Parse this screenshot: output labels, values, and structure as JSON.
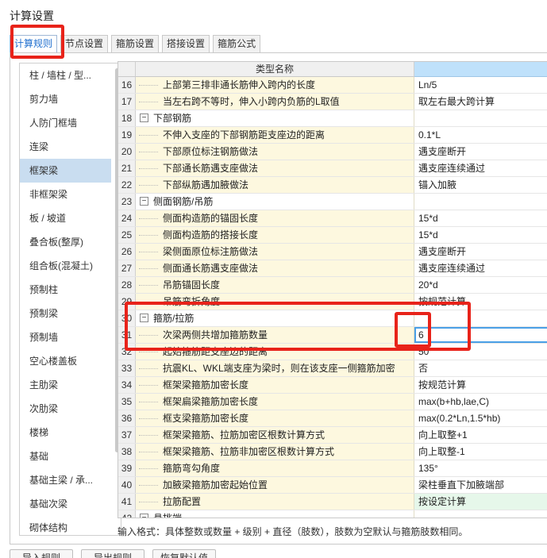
{
  "window": {
    "title": "计算设置"
  },
  "tabs": [
    {
      "label": "计算规则"
    },
    {
      "label": "节点设置"
    },
    {
      "label": "箍筋设置"
    },
    {
      "label": "搭接设置"
    },
    {
      "label": "箍筋公式"
    }
  ],
  "sidebar": {
    "items": [
      {
        "label": "柱 / 墙柱 / 型..."
      },
      {
        "label": "剪力墙"
      },
      {
        "label": "人防门框墙"
      },
      {
        "label": "连梁"
      },
      {
        "label": "框架梁"
      },
      {
        "label": "非框架梁"
      },
      {
        "label": "板 / 坡道"
      },
      {
        "label": "叠合板(整厚)"
      },
      {
        "label": "组合板(混凝土)"
      },
      {
        "label": "预制柱"
      },
      {
        "label": "预制梁"
      },
      {
        "label": "预制墙"
      },
      {
        "label": "空心楼盖板"
      },
      {
        "label": "主肋梁"
      },
      {
        "label": "次肋梁"
      },
      {
        "label": "楼梯"
      },
      {
        "label": "基础"
      },
      {
        "label": "基础主梁 / 承..."
      },
      {
        "label": "基础次梁"
      },
      {
        "label": "砌体结构"
      }
    ]
  },
  "grid": {
    "header": {
      "name": "类型名称",
      "value": ""
    },
    "rows": [
      {
        "num": "16",
        "name": "上部第三排非通长筋伸入跨内的长度",
        "value": "Ln/5"
      },
      {
        "num": "17",
        "name": "当左右跨不等时，伸入小跨内负筋的L取值",
        "value": "取左右最大跨计算"
      },
      {
        "num": "18",
        "name": "下部钢筋",
        "value": "",
        "group": "true"
      },
      {
        "num": "19",
        "name": "不伸入支座的下部钢筋距支座边的距离",
        "value": "0.1*L"
      },
      {
        "num": "20",
        "name": "下部原位标注钢筋做法",
        "value": "遇支座断开"
      },
      {
        "num": "21",
        "name": "下部通长筋遇支座做法",
        "value": "遇支座连续通过"
      },
      {
        "num": "22",
        "name": "下部纵筋遇加腋做法",
        "value": "锚入加腋"
      },
      {
        "num": "23",
        "name": "侧面钢筋/吊筋",
        "value": "",
        "group": "true"
      },
      {
        "num": "24",
        "name": "侧面构造筋的锚固长度",
        "value": "15*d"
      },
      {
        "num": "25",
        "name": "侧面构造筋的搭接长度",
        "value": "15*d"
      },
      {
        "num": "26",
        "name": "梁侧面原位标注筋做法",
        "value": "遇支座断开"
      },
      {
        "num": "27",
        "name": "侧面通长筋遇支座做法",
        "value": "遇支座连续通过"
      },
      {
        "num": "28",
        "name": "吊筋锚固长度",
        "value": "20*d"
      },
      {
        "num": "29",
        "name": "吊筋弯折角度",
        "value": "按规范计算"
      },
      {
        "num": "30",
        "name": "箍筋/拉筋",
        "value": "",
        "group": "true"
      },
      {
        "num": "31",
        "name": "次梁两侧共增加箍筋数量",
        "value": "6",
        "editing": "true"
      },
      {
        "num": "32",
        "name": "起始箍筋距支座边的距离",
        "value": "50"
      },
      {
        "num": "33",
        "name": "抗震KL、WKL端支座为梁时，则在该支座一侧箍筋加密",
        "value": "否"
      },
      {
        "num": "34",
        "name": "框架梁箍筋加密长度",
        "value": "按规范计算"
      },
      {
        "num": "35",
        "name": "框架扁梁箍筋加密长度",
        "value": "max(b+hb,lae,C)"
      },
      {
        "num": "36",
        "name": "框支梁箍筋加密长度",
        "value": "max(0.2*Ln,1.5*hb)"
      },
      {
        "num": "37",
        "name": "框架梁箍筋、拉筋加密区根数计算方式",
        "value": "向上取整+1"
      },
      {
        "num": "38",
        "name": "框架梁箍筋、拉筋非加密区根数计算方式",
        "value": "向上取整-1"
      },
      {
        "num": "39",
        "name": "箍筋弯勾角度",
        "value": "135°"
      },
      {
        "num": "40",
        "name": "加腋梁箍筋加密起始位置",
        "value": "梁柱垂直下加腋端部"
      },
      {
        "num": "41",
        "name": "拉筋配置",
        "value": "按设定计算",
        "green": "true"
      },
      {
        "num": "42",
        "name": "悬挑端",
        "value": "",
        "group": "true"
      }
    ]
  },
  "hint": {
    "text": "输入格式：具体整数或数量 + 级别 + 直径（肢数），肢数为空默认与箍筋肢数相同。"
  },
  "bottom_buttons": [
    {
      "label": "导入规则"
    },
    {
      "label": "导出规则"
    },
    {
      "label": "恢复默认值"
    }
  ],
  "colors": {
    "highlight": "#e8231a",
    "selected": "#c9ddf0",
    "name_cell": "#fdf8df",
    "accent": "#1f6fcf"
  }
}
